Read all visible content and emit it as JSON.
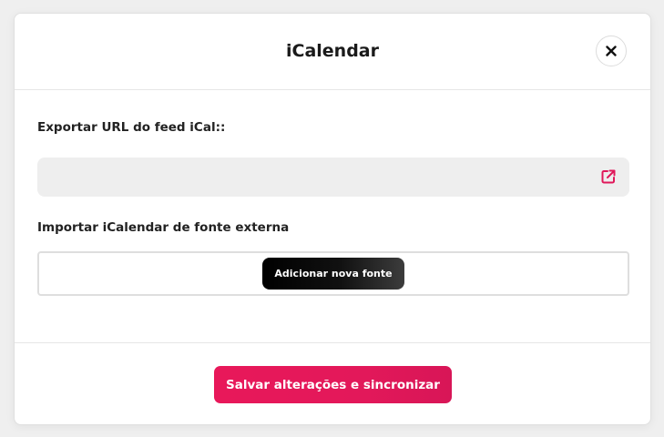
{
  "modal": {
    "title": "iCalendar",
    "close_icon": "close-icon"
  },
  "export": {
    "label": "Exportar URL do feed iCal::",
    "url_value": "",
    "link_icon": "external-link-icon",
    "accent_color": "#e0185a"
  },
  "import": {
    "label": "Importar iCalendar de fonte externa",
    "add_button_label": "Adicionar nova fonte"
  },
  "footer": {
    "save_button_label": "Salvar alterações e sincronizar",
    "save_button_color": "#e3185a"
  }
}
